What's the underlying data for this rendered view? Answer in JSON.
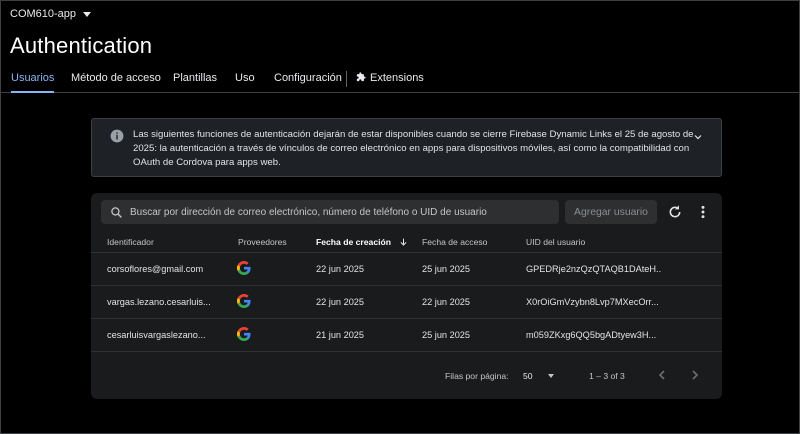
{
  "header": {
    "project_name": "COM610-app",
    "title": "Authentication"
  },
  "tabs": [
    {
      "label": "Usuarios",
      "active": true
    },
    {
      "label": "Método de acceso",
      "active": false
    },
    {
      "label": "Plantillas",
      "active": false
    },
    {
      "label": "Uso",
      "active": false
    },
    {
      "label": "Configuración",
      "active": false
    },
    {
      "label": "Extensions",
      "active": false,
      "icon": "extensions-icon"
    }
  ],
  "banner": {
    "icon": "info-icon",
    "message": "Las siguientes funciones de autenticación dejarán de estar disponibles cuando se cierre Firebase Dynamic Links el 25 de agosto de 2025: la autenticación a través de vínculos de correo electrónico en apps para dispositivos móviles, así como la compatibilidad con OAuth de Cordova para apps web."
  },
  "users_table": {
    "search_placeholder": "Buscar por dirección de correo electrónico, número de teléfono o UID de usuario",
    "add_user_label": "Agregar usuario",
    "columns": [
      "Identificador",
      "Proveedores",
      "Fecha de creación",
      "Fecha de acceso",
      "UID del usuario"
    ],
    "sorted_column": "Fecha de creación",
    "rows": [
      {
        "identifier": "corsoflores@gmail.com",
        "provider": "google-icon",
        "created": "22 jun 2025",
        "signed_in": "25 jun 2025",
        "uid": "GPEDRje2nzQzQTAQB1DAteH..."
      },
      {
        "identifier": "vargas.lezano.cesarluis...",
        "provider": "google-icon",
        "created": "22 jun 2025",
        "signed_in": "22 jun 2025",
        "uid": "X0rOiGmVzybn8Lvp7MXecOrr..."
      },
      {
        "identifier": "cesarluisvargaslezano...",
        "provider": "google-icon",
        "created": "21 jun 2025",
        "signed_in": "25 jun 2025",
        "uid": "m059ZKxg6QQ5bgADtyew3H..."
      }
    ],
    "footer": {
      "rows_per_page_label": "Filas por página:",
      "rows_per_page_value": "50",
      "range_text": "1 – 3 of 3"
    }
  },
  "colors": {
    "accent": "#8ab4f8",
    "background": "#000000",
    "card": "#1a1b1d",
    "banner": "#1e2227"
  }
}
